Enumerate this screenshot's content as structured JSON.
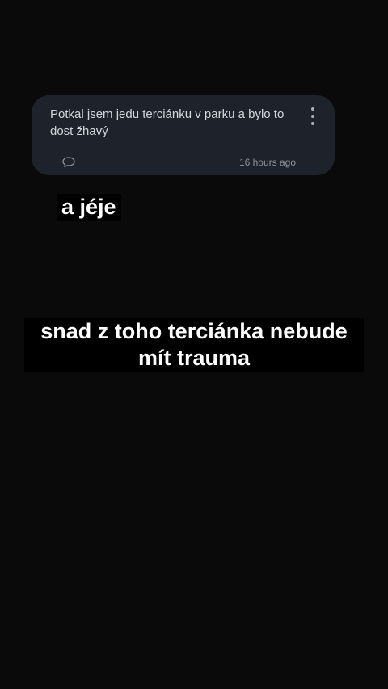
{
  "post": {
    "text": "Potkal jsem jedu terciánku v parku a bylo to dost žhavý",
    "timestamp": "16 hours ago",
    "more_icon": "more-vertical-icon",
    "comment_icon": "comment-icon"
  },
  "captions": {
    "first": "a jéje",
    "second": "snad z toho terciánka nebude mít trauma"
  },
  "colors": {
    "background": "#0a0a0b",
    "card": "#1e232b",
    "post_text": "#d2d6dd",
    "muted": "#8c939d",
    "caption_text": "#ffffff",
    "caption_bg": "#000000"
  }
}
